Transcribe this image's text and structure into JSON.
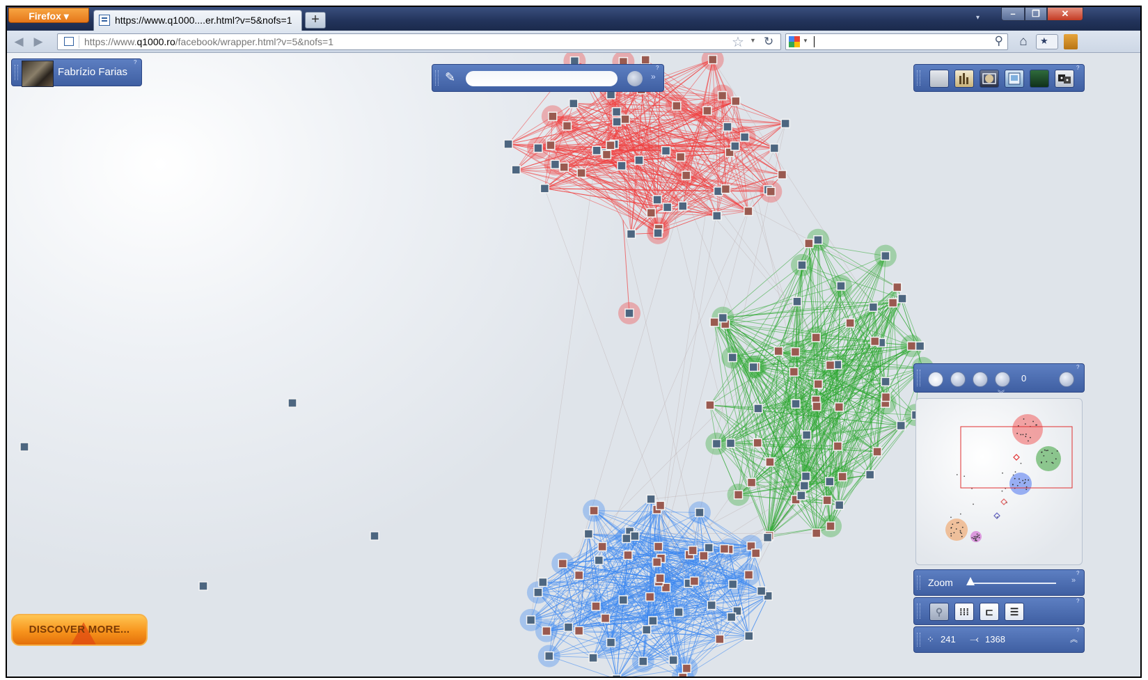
{
  "browser": {
    "menu_label": "Firefox",
    "tab_title": "https://www.q1000....er.html?v=5&nofs=1",
    "new_tab_label": "+",
    "url_prefix": "https://www.",
    "url_domain": "q1000.ro",
    "url_path": "/facebook/wrapper.html?v=5&nofs=1",
    "search_value": ""
  },
  "app": {
    "user_name": "Fabrízio Farias",
    "search_placeholder": "",
    "selection_count": "0",
    "zoom_label": "Zoom",
    "zoom_level": 0.0,
    "node_count": "241",
    "edge_count": "1368",
    "discover_label": "DISCOVER MORE..."
  },
  "colors": {
    "cluster_red": "#f04040",
    "cluster_green": "#2ea832",
    "cluster_blue": "#3a86f0",
    "panel_blue": "#4a6db3",
    "discover_orange": "#f7941d"
  },
  "tools": [
    "blank-tool",
    "chart-tool",
    "photo-tool",
    "frame-tool",
    "green-tool",
    "dice-tool"
  ],
  "layout_buttons": [
    "search-layout",
    "grid-layout",
    "tree-layout",
    "list-layout"
  ]
}
